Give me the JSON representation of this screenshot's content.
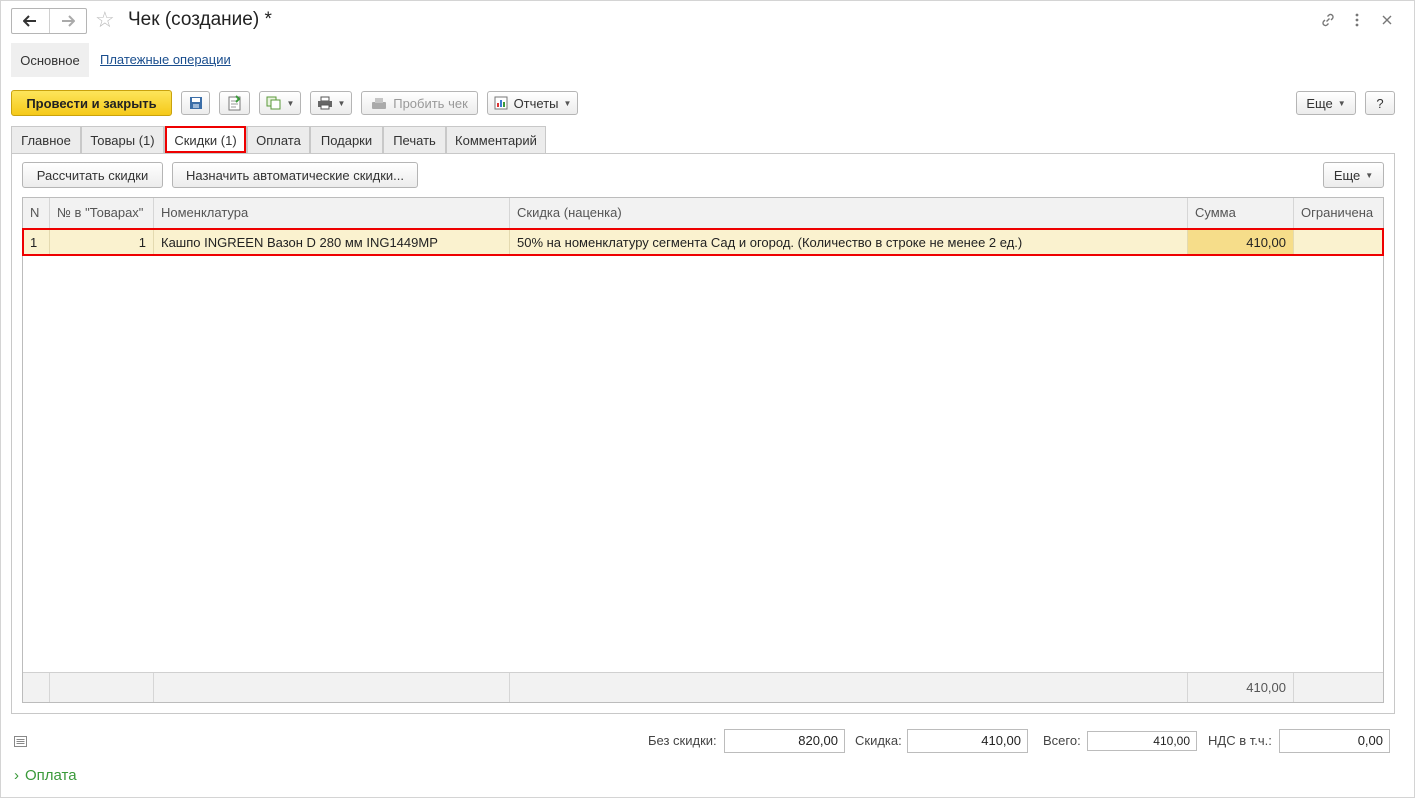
{
  "window": {
    "title": "Чек (создание) *",
    "icons": [
      "back-arrow-icon",
      "forward-arrow-icon",
      "star-icon",
      "link-icon",
      "more-vertical-icon",
      "close-icon"
    ]
  },
  "sections": {
    "main": "Основное",
    "payments_link": "Платежные операции"
  },
  "toolbar": {
    "post_close": "Провести и закрыть",
    "print_receipt": "Пробить чек",
    "reports": "Отчеты",
    "more": "Еще",
    "help": "?"
  },
  "tabs": [
    {
      "label": "Главное"
    },
    {
      "label": "Товары (1)"
    },
    {
      "label": "Скидки (1)",
      "active": true
    },
    {
      "label": "Оплата"
    },
    {
      "label": "Подарки"
    },
    {
      "label": "Печать"
    },
    {
      "label": "Комментарий"
    }
  ],
  "discounts_toolbar": {
    "calculate": "Рассчитать скидки",
    "assign_auto": "Назначить автоматические скидки...",
    "more": "Еще"
  },
  "grid": {
    "columns": [
      "N",
      "№ в \"Товарах\"",
      "Номенклатура",
      "Скидка (наценка)",
      "Сумма",
      "Ограничена"
    ],
    "rows": [
      {
        "n": "1",
        "goods_no": "1",
        "item": "Кашпо INGREEN Вазон D 280 мм ING1449MP",
        "discount": "50% на номенклатуру сегмента Сад и огород. (Количество в строке не менее 2 ед.)",
        "sum": "410,00",
        "limited": ""
      }
    ],
    "footer_sum": "410,00"
  },
  "totals": {
    "no_discount_label": "Без скидки:",
    "no_discount_value": "820,00",
    "discount_label": "Скидка:",
    "discount_value": "410,00",
    "total_label": "Всего:",
    "total_value": "410,00",
    "vat_label": "НДС в т.ч.:",
    "vat_value": "0,00"
  },
  "collapsible": {
    "payment_label": "Оплата"
  },
  "colors": {
    "primary_button": "#f5c919",
    "highlight": "#e00000",
    "row_background": "#faf2cf",
    "link": "#1a4e8e",
    "group_title": "#3a9a3a"
  }
}
